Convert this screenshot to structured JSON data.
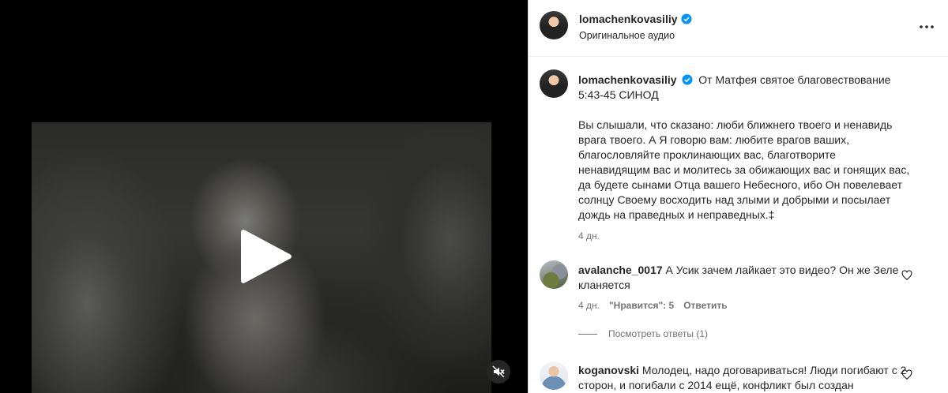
{
  "post_header": {
    "username": "lomachenkovasiliy",
    "audio": "Оригинальное аудио"
  },
  "caption": {
    "username": "lomachenkovasiliy",
    "title": "От Матфея святое благовествование 5:43-45 СИНОД",
    "body": "Вы слышали, что сказано: люби ближнего твоего и ненавидь врага твоего. А Я говорю вам: любите врагов ваших, благословляйте проклинающих вас, благотворите ненавидящим вас и молитесь за обижающих вас и гонящих вас, да будете сынами Отца вашего Небесного, ибо Он повелевает солнцу Своему восходить над злыми и добрыми и посылает дождь на праведных и неправедных.‡",
    "time": "4 дн."
  },
  "comments": [
    {
      "username": "avalanche_0017",
      "text": "А Усик зачем лайкает это видео? Он же Зеле кланяется",
      "time": "4 дн.",
      "likes": "\"Нравится\": 5",
      "reply": "Ответить",
      "view_replies": "Посмотреть ответы (1)"
    },
    {
      "username": "koganovski",
      "text": "Молодец, надо договариваться! Люди погибают с 2 сторон, и погибали с 2014 ещё, конфликт был создан"
    }
  ],
  "colors": {
    "verified": "#0095f6",
    "media_bg": "#000000",
    "secondary_text": "#737373"
  },
  "icons": [
    "verified-badge-icon",
    "more-options-icon",
    "play-icon",
    "mute-icon",
    "heart-icon"
  ]
}
